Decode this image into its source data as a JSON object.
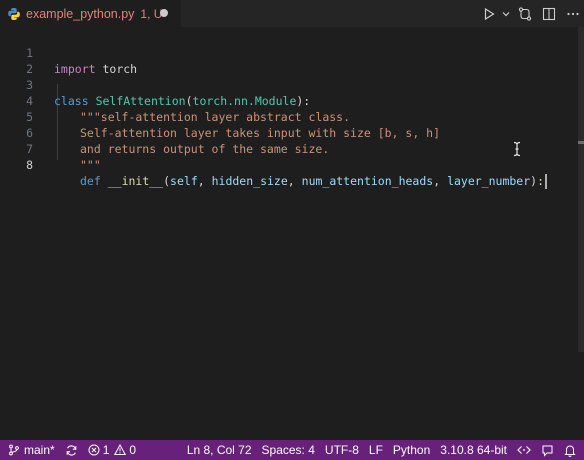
{
  "tab": {
    "filename": "example_python.py",
    "status": "1, U"
  },
  "toolbar": {
    "icons": [
      "run-icon",
      "chevron-down-icon",
      "compare-changes-icon",
      "split-editor-icon",
      "more-actions-icon"
    ]
  },
  "editor": {
    "lines": [
      {
        "number": "1"
      },
      {
        "number": "2"
      },
      {
        "number": "3"
      },
      {
        "number": "4"
      },
      {
        "number": "5"
      },
      {
        "number": "6"
      },
      {
        "number": "7"
      },
      {
        "number": "8"
      }
    ],
    "code": {
      "l1_kw": "import",
      "l1_rest": " torch",
      "l3_kw": "class",
      "l3_cls": "SelfAttention",
      "l3_paren": "(",
      "l3_base": "torch.nn.Module",
      "l3_end": "):",
      "l4": "\"\"\"self-attention layer abstract class.",
      "l5": "Self-attention layer takes input with size [b, s, h]",
      "l6": "and returns output of the same size.",
      "l7": "\"\"\"",
      "l8_def": "def",
      "l8_fn": "__init__",
      "l8_open": "(",
      "l8_p1": "self",
      "l8_c1": ", ",
      "l8_p2": "hidden_size",
      "l8_c2": ", ",
      "l8_p3": "num_attention_heads",
      "l8_c3": ", ",
      "l8_p4": "layer_number",
      "l8_close": "):"
    },
    "active_line": "8"
  },
  "statusbar": {
    "branch": "main*",
    "errors": "1",
    "warnings": "0",
    "position": "Ln 8, Col 72",
    "spaces": "Spaces: 4",
    "encoding": "UTF-8",
    "eol": "LF",
    "language": "Python",
    "interpreter": "3.10.8 64-bit",
    "accent_color": "#68217a"
  },
  "colors": {
    "editor_bg": "#1e1e1e",
    "keyword_blue": "#569cd6",
    "keyword_purple": "#c586c0",
    "class_name": "#4ec9b0",
    "string": "#ce9178",
    "function": "#dcdcaa",
    "variable": "#9cdcfe",
    "modified_tab": "#e5807a"
  }
}
